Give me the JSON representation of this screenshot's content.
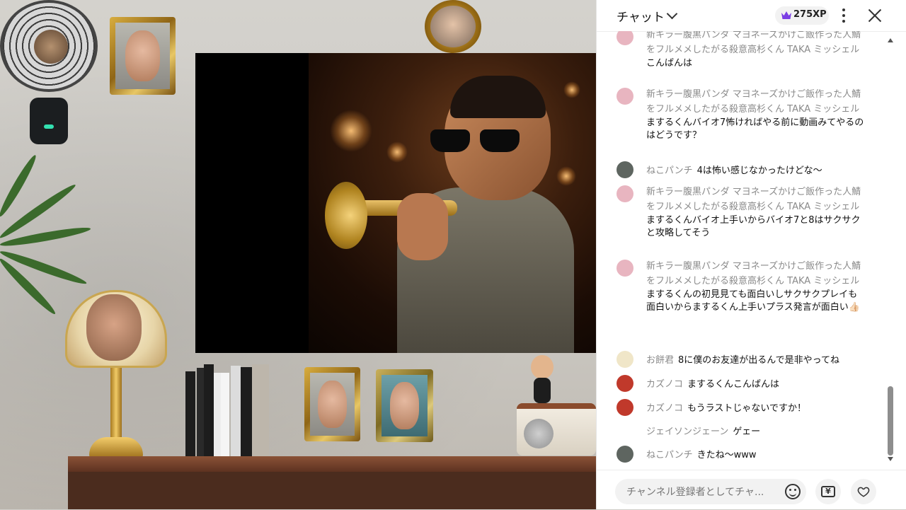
{
  "chat": {
    "header": {
      "title": "チャット",
      "xp": "275XP"
    },
    "messages": [
      {
        "user": "新キラー腹黒パンダ マヨネーズかけご飯作った人鯖をフルメメしたがる殺意高杉くん TAKA ミッシェル",
        "text": "こんばんは",
        "avatar_color": "#e8b5c0"
      },
      {
        "user": "新キラー腹黒パンダ マヨネーズかけご飯作った人鯖をフルメメしたがる殺意高杉くん TAKA ミッシェル",
        "text": "まするくんバイオ7怖ければやる前に動画みてやるのはどうです？",
        "avatar_color": "#e8b5c0"
      },
      {
        "user": "ねこパンチ",
        "text": "4は怖い感じなかったけどな～",
        "avatar_color": "#5e6560"
      },
      {
        "user": "新キラー腹黒パンダ マヨネーズかけご飯作った人鯖をフルメメしたがる殺意高杉くん TAKA ミッシェル",
        "text": "まするくんバイオ上手いからバイオ7と8はサクサクと攻略してそう",
        "avatar_color": "#e8b5c0"
      },
      {
        "user": "新キラー腹黒パンダ マヨネーズかけご飯作った人鯖をフルメメしたがる殺意高杉くん TAKA ミッシェル",
        "text": "まするくんの初見見ても面白いしサクサクプレイも面白いからまするくん上手いプラス発言が面白い👍🏻",
        "avatar_color": "#e8b5c0"
      },
      {
        "user": "お餅君",
        "text": "8に僕のお友達が出るんで是非やってね",
        "avatar_color": "#f0e6c8"
      },
      {
        "user": "カズノコ",
        "text": "まするくんこんばんは",
        "avatar_color": "#c0392b"
      },
      {
        "user": "カズノコ",
        "text": "もうラストじゃないですか！",
        "avatar_color": "#c0392b"
      },
      {
        "user": "ジェイソンジェーン",
        "text": "ゲェー",
        "avatar_color": ""
      },
      {
        "user": "ねこパンチ",
        "text": "きたね～www",
        "avatar_color": "#5e6560"
      }
    ],
    "input": {
      "placeholder": "チャンネル登録者としてチャ..."
    },
    "icons": {
      "dropdown": "chevron-down-icon",
      "xp": "crown-icon",
      "more": "more-vert-icon",
      "close": "close-icon",
      "emoji": "emoji-icon",
      "tip": "yen-icon",
      "like": "heart-icon"
    },
    "colors": {
      "xp_crown": "#7b3fe4",
      "username": "#8a8a8a"
    }
  }
}
